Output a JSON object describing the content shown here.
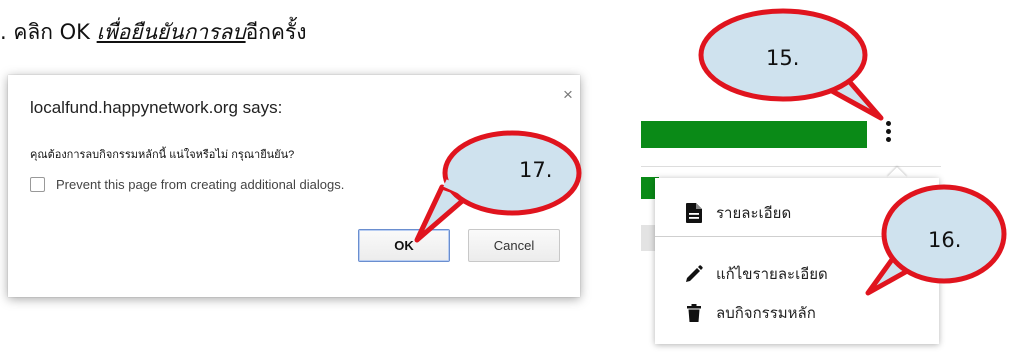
{
  "instruction": {
    "step_prefix": ". คลิก OK ",
    "emphasis": "เพื่อยืนยันการลบ",
    "suffix": "อีกครั้ง"
  },
  "dialog": {
    "title": "localfund.happynetwork.org says:",
    "close_glyph": "×",
    "message": "คุณต้องการลบกิจกรรมหลักนี้ แน่ใจหรือไม่ กรุณายืนยัน?",
    "prevent_label": "Prevent this page from creating additional dialogs.",
    "prevent_checked": false,
    "ok_label": "OK",
    "cancel_label": "Cancel"
  },
  "menu": {
    "items": [
      {
        "label": "รายละเอียด",
        "icon": "document-icon"
      },
      {
        "label": "แก้ไขรายละเอียด",
        "icon": "pencil-icon"
      },
      {
        "label": "ลบกิจกรรมหลัก",
        "icon": "trash-icon"
      }
    ]
  },
  "callouts": {
    "step15": "15.",
    "step16": "16.",
    "step17": "17."
  },
  "colors": {
    "callout_fill": "#cfe2ee",
    "callout_stroke": "#e0141e",
    "green": "#0a8a17",
    "ok_border": "#6a8ecf"
  }
}
